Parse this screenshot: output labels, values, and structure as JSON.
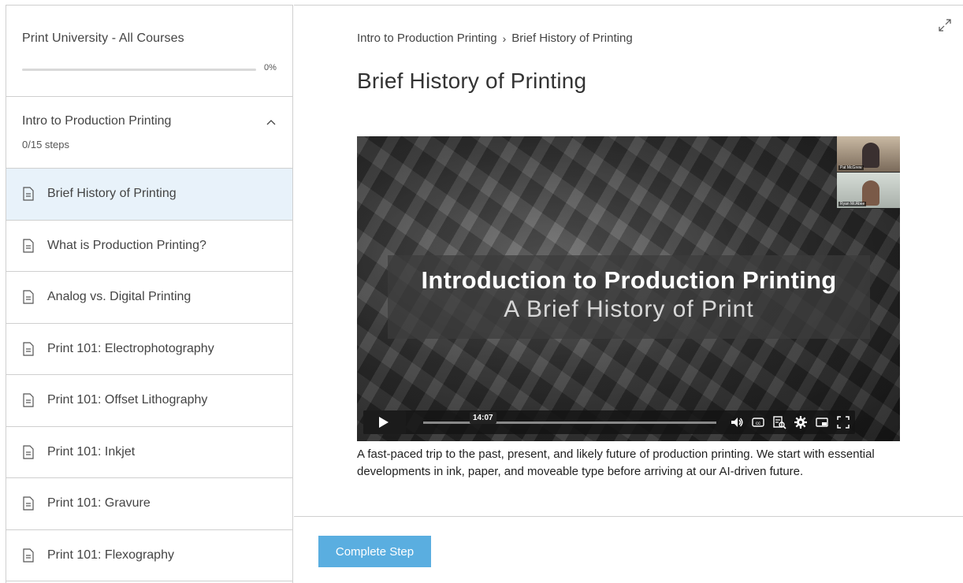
{
  "sidebar": {
    "course_title": "Print University - All Courses",
    "progress_pct": "0%",
    "progress_value": 0,
    "lesson": {
      "title": "Intro to Production Printing",
      "steps": "0/15 steps"
    },
    "items": [
      {
        "label": "Brief History of Printing",
        "active": true
      },
      {
        "label": "What is Production Printing?"
      },
      {
        "label": "Analog vs. Digital Printing"
      },
      {
        "label": "Print 101: Electrophotography"
      },
      {
        "label": "Print 101: Offset Lithography"
      },
      {
        "label": "Print 101: Inkjet"
      },
      {
        "label": "Print 101: Gravure"
      },
      {
        "label": "Print 101: Flexography"
      }
    ]
  },
  "main": {
    "breadcrumb": {
      "parent": "Intro to Production Printing",
      "current": "Brief History of Printing"
    },
    "title": "Brief History of Printing",
    "video": {
      "title": "Introduction to Production Printing",
      "subtitle": "A Brief History of Print",
      "time": "14:07",
      "participants": [
        "Pat McGrew",
        "Ryan McAbee"
      ]
    },
    "description": "A fast-paced trip to the past, present, and likely future of production printing. We start with essential developments in ink, paper, and moveable type before arriving at our AI-driven future.",
    "complete_button": "Complete Step"
  },
  "colors": {
    "accent": "#5aaee0",
    "active_row": "#e8f2fa"
  }
}
